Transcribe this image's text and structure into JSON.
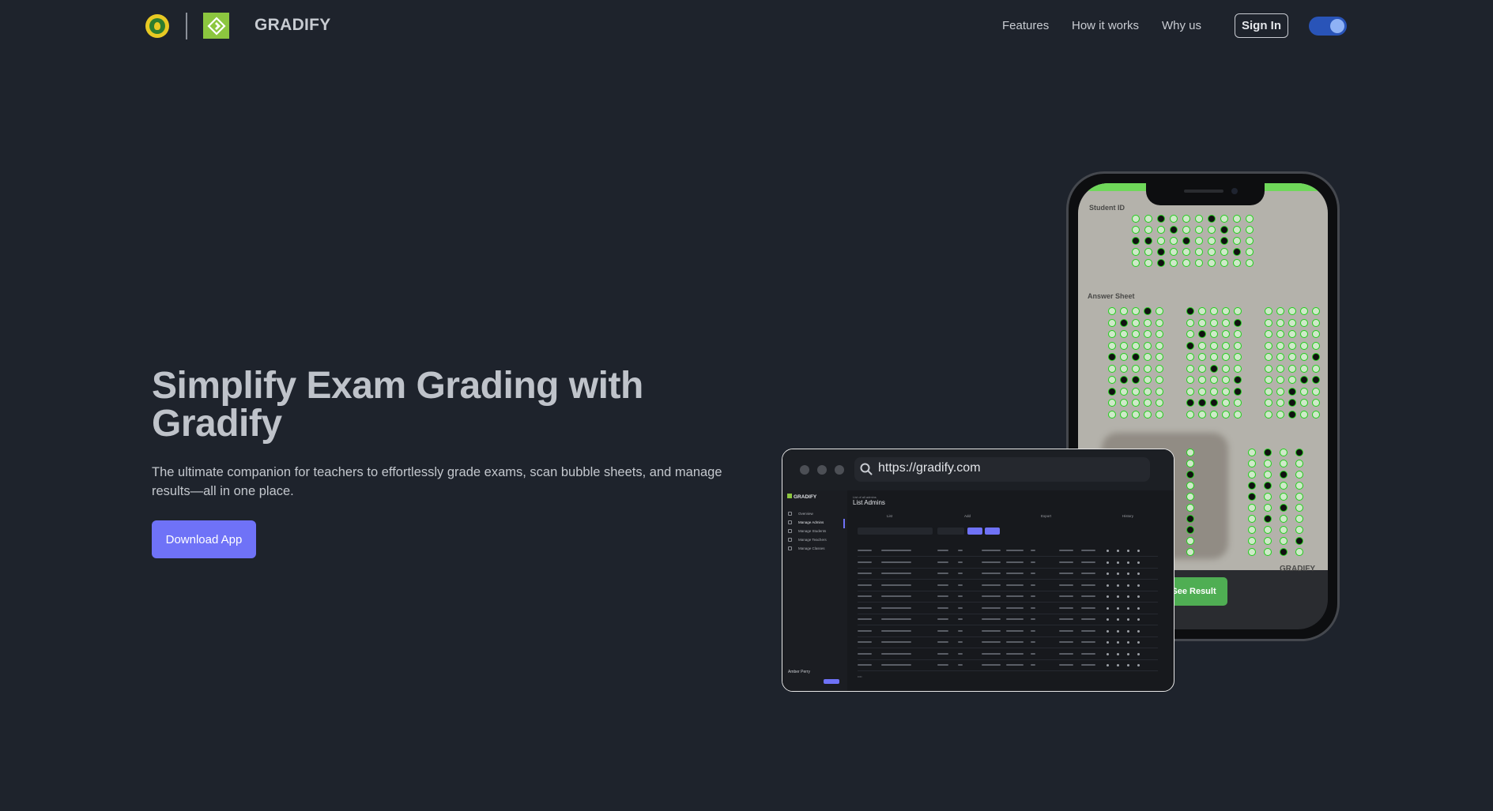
{
  "nav": {
    "brand": "GRADIFY",
    "links": [
      {
        "label": "Features"
      },
      {
        "label": "How it works"
      },
      {
        "label": "Why us"
      }
    ],
    "signin_label": "Sign In",
    "theme_toggle_on": true
  },
  "hero": {
    "title": "Simplify Exam Grading with Gradify",
    "subtitle": "The ultimate companion for teachers to effortlessly grade exams, scan bubble sheets, and manage results—all in one place.",
    "cta_label": "Download App"
  },
  "phone": {
    "student_id_label": "Student ID",
    "answer_sheet_label": "Answer Sheet",
    "scan_brand": "GRADIFY",
    "see_result_label": "See Result"
  },
  "browser": {
    "url": "https://gradify.com",
    "app_brand": "GRADIFY",
    "sidebar_items": [
      "Overview",
      "Manage Admins",
      "Manage Students",
      "Manage Teachers",
      "Manage Classes"
    ],
    "crumb": "List of all admins",
    "page_title": "List Admins",
    "tabs": [
      "List",
      "Add",
      "Export",
      "History"
    ],
    "user_name": "Amber Perry"
  },
  "colors": {
    "background": "#1e232c",
    "accent": "#6f72f7",
    "success": "#4fae53",
    "brand_green": "#8cc63f"
  }
}
